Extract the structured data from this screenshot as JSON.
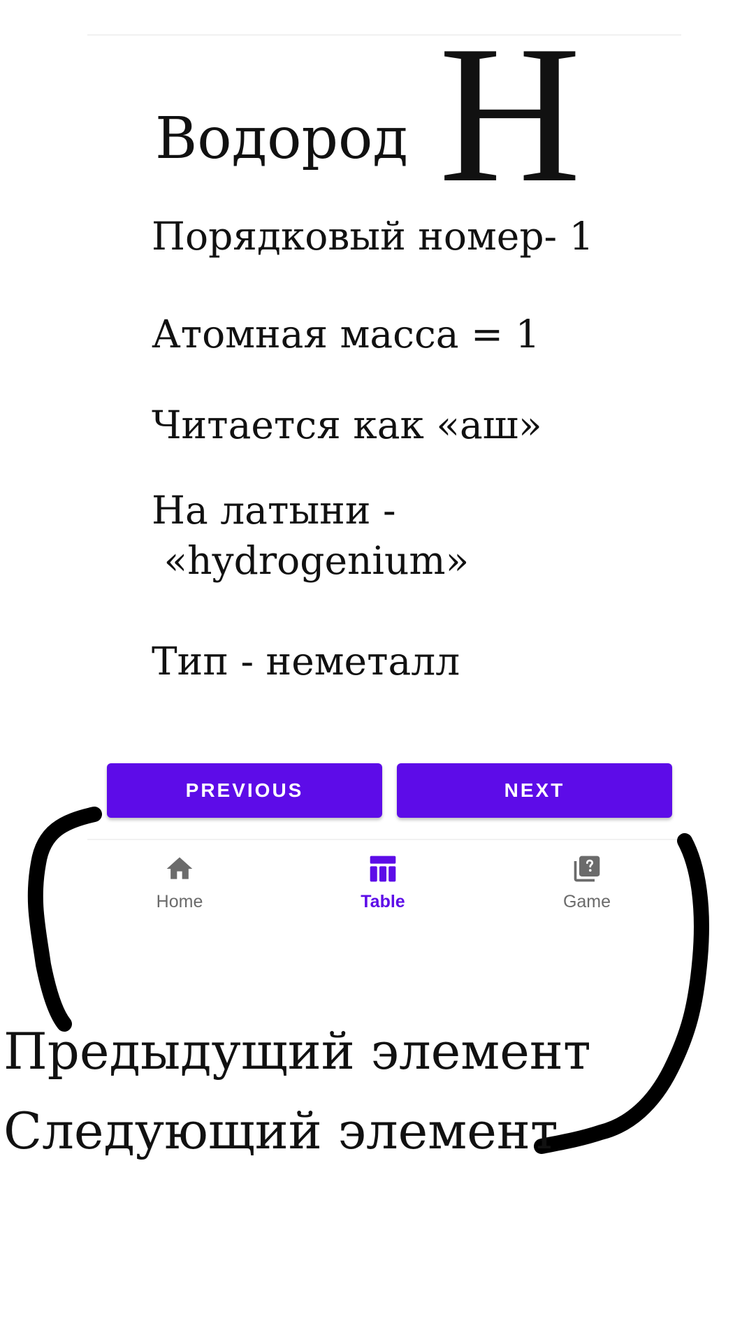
{
  "element": {
    "name": "Водород",
    "symbol": "H"
  },
  "info": {
    "number": "Порядковый номер- 1",
    "mass": "Атомная масса = 1",
    "reading": "Читается как «аш»",
    "latin_line1": "На латыни -",
    "latin_line2": " «hydrogenium»",
    "type": "Тип - неметалл"
  },
  "buttons": {
    "previous": "PREVIOUS",
    "next": "NEXT"
  },
  "nav": {
    "items": [
      {
        "label": "Home",
        "icon": "home-icon",
        "active": false
      },
      {
        "label": "Table",
        "icon": "table-icon",
        "active": true
      },
      {
        "label": "Game",
        "icon": "quiz-icon",
        "active": false
      }
    ]
  },
  "annotations": {
    "previous_caption": "Предыдущий элемент",
    "next_caption": "Следующий элемент"
  },
  "colors": {
    "accent": "#5d0ce8",
    "nav_inactive": "#6b6b6b",
    "annotation_stroke": "#000000"
  }
}
